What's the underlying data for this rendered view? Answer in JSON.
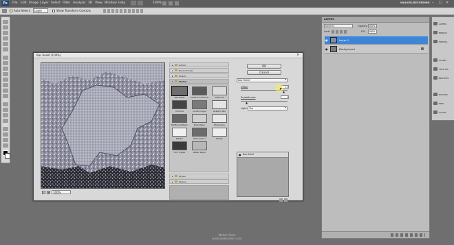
{
  "menubar": {
    "logo": "Ps",
    "items": [
      "File",
      "Edit",
      "Image",
      "Layer",
      "Select",
      "Filter",
      "Analysis",
      "3D",
      "View",
      "Window",
      "Help"
    ],
    "zoom": "100%",
    "workspace": "WALKER_RECORDING"
  },
  "options": {
    "auto_select_label": "Auto-Select:",
    "auto_select_value": "Layer",
    "transform_label": "Show Transform Controls"
  },
  "dialog": {
    "title": "Bas Relief (100%)",
    "ok": "OK",
    "cancel": "Cancel",
    "zoom": "100%",
    "categories_top": [
      "Artistic",
      "Brush Strokes",
      "Distort",
      "Sketch"
    ],
    "categories_bottom": [
      "Stylize",
      "Texture"
    ],
    "thumbs": [
      "Bas Relief",
      "Chalk & Charcoal",
      "Charcoal",
      "Chrome",
      "Conté Crayon",
      "Graphic Pen",
      "Halftone Pattern",
      "Note Paper",
      "Photocopy",
      "Plaster",
      "Reticulation",
      "Stamp",
      "Torn Edges",
      "Water Paper"
    ],
    "filter_select": "Bas Relief",
    "detail_label": "Detail",
    "detail_value": "13",
    "smooth_label": "Smoothness",
    "smooth_value": "3",
    "light_label": "Light:",
    "light_value": "Top",
    "layer_item": "Bas Relief"
  },
  "layers": {
    "tab": "LAYERS",
    "blend": "Normal",
    "opacity_label": "Opacity:",
    "opacity": "100%",
    "lock_label": "Lock:",
    "fill_label": "Fill:",
    "fill": "100%",
    "rows": [
      "Layer 1",
      "Background"
    ]
  },
  "dock": {
    "items": [
      "LAYERS",
      "BRIDGE",
      "MINI BR...",
      "CLONE...",
      "TOOL PR...",
      "BRUSHES",
      "HISTORY",
      "INFO",
      "COLOR"
    ]
  },
  "watermark": {
    "line1": "Walker Stein",
    "line2": "www.walkerstein.com"
  },
  "colors": {
    "selected_row": "#3c86d9",
    "menubar": "#5e5e5e",
    "workspace": "#6f6f6f"
  }
}
